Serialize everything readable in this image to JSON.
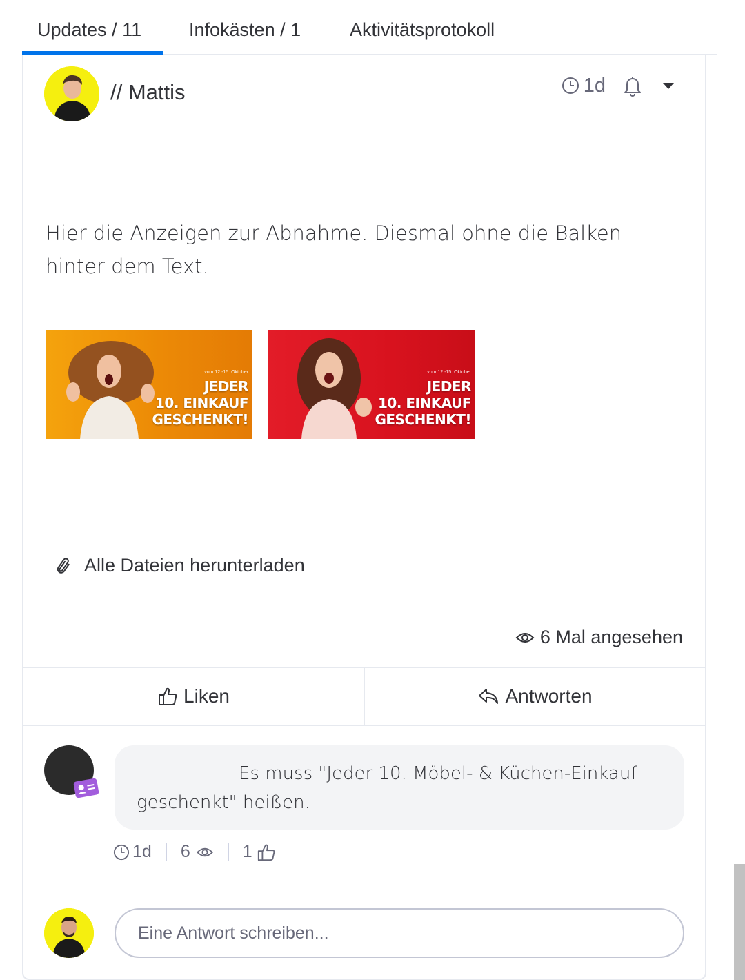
{
  "tabs": [
    {
      "label": "Updates / 11",
      "active": true
    },
    {
      "label": "Infokästen / 1",
      "active": false
    },
    {
      "label": "Aktivitätsprotokoll",
      "active": false
    }
  ],
  "post": {
    "author": "// Mattis",
    "time": "1d",
    "text": "Hier die Anzeigen zur Abnahme. Diesmal ohne die Balken hinter dem Text.",
    "attachments": [
      {
        "text_small": "vom 12.-15. Oktober",
        "line1": "JEDER",
        "line2": "10. EINKAUF",
        "line3": "GESCHENKT!",
        "background": "#f08a0a"
      },
      {
        "text_small": "vom 12.-15. Oktober",
        "line1": "JEDER",
        "line2": "10. EINKAUF",
        "line3": "GESCHENKT!",
        "background": "#d9101c"
      }
    ],
    "download_label": "Alle Dateien herunterladen",
    "views_label": "6 Mal angesehen"
  },
  "actions": {
    "like_label": "Liken",
    "reply_label": "Antworten"
  },
  "reply": {
    "text": "Es muss \"Jeder 10. Möbel- & Küchen-Einkauf geschenkt\" heißen.",
    "time": "1d",
    "views": "6",
    "likes": "1"
  },
  "composer": {
    "placeholder": "Eine Antwort schreiben..."
  },
  "colors": {
    "accent": "#0073ea",
    "avatar_bg": "#f5ef0f",
    "guest_badge": "#a25ddc",
    "bubble": "#f3f4f6"
  }
}
